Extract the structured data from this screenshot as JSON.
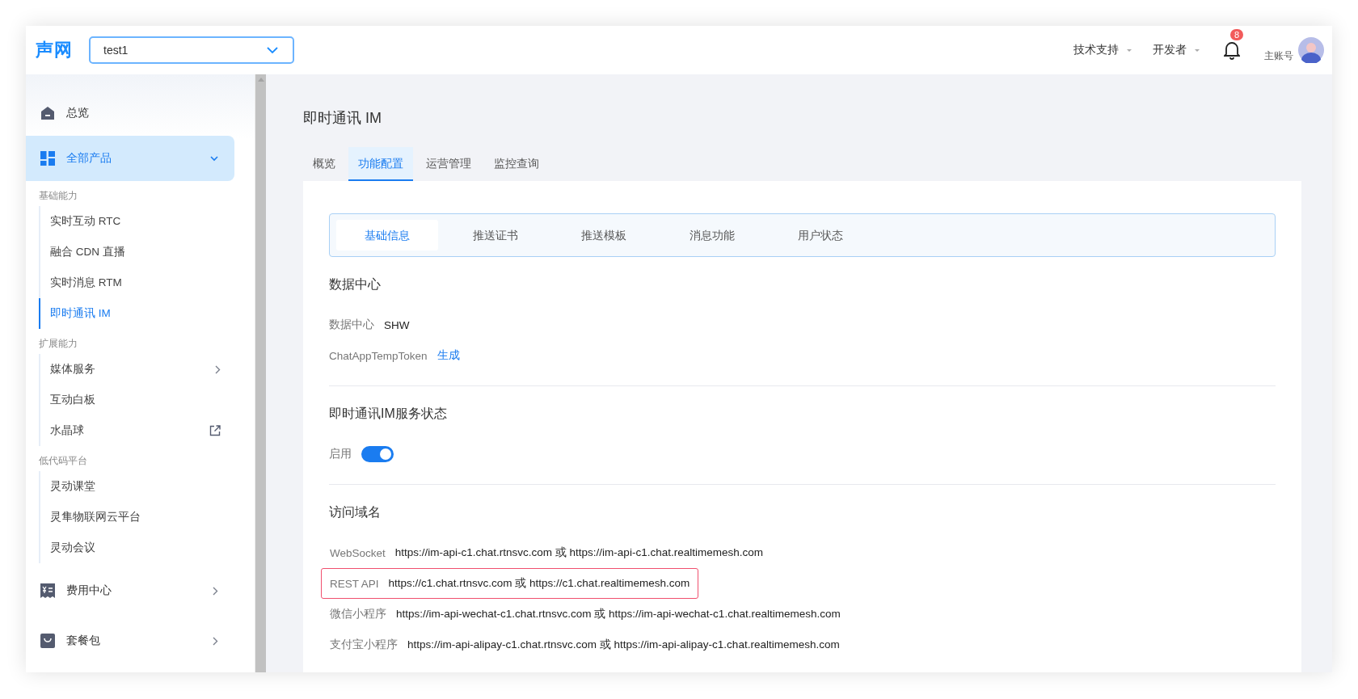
{
  "header": {
    "logo": "声网",
    "project_select": {
      "value": "test1"
    },
    "menus": [
      {
        "label": "技术支持"
      },
      {
        "label": "开发者"
      }
    ],
    "notifications": {
      "count": "8"
    },
    "account": {
      "role": "主账号"
    }
  },
  "sidebar": {
    "top_items": [
      {
        "label": "总览",
        "kind": "home"
      }
    ],
    "products": {
      "label": "全部产品",
      "expanded": true,
      "groups": [
        {
          "title": "基础能力",
          "items": [
            {
              "label": "实时互动 RTC",
              "kind": "plain",
              "selected": false
            },
            {
              "label": "融合 CDN 直播",
              "kind": "plain",
              "selected": false
            },
            {
              "label": "实时消息 RTM",
              "kind": "plain",
              "selected": false
            },
            {
              "label": "即时通讯 IM",
              "kind": "plain",
              "selected": true
            }
          ]
        },
        {
          "title": "扩展能力",
          "items": [
            {
              "label": "媒体服务",
              "kind": "submenu",
              "selected": false
            },
            {
              "label": "互动白板",
              "kind": "plain",
              "selected": false
            },
            {
              "label": "水晶球",
              "kind": "external",
              "selected": false
            }
          ]
        },
        {
          "title": "低代码平台",
          "items": [
            {
              "label": "灵动课堂",
              "kind": "plain",
              "selected": false
            },
            {
              "label": "灵隼物联网云平台",
              "kind": "plain",
              "selected": false
            },
            {
              "label": "灵动会议",
              "kind": "plain",
              "selected": false
            }
          ]
        }
      ]
    },
    "bottom_items": [
      {
        "label": "费用中心",
        "kind": "bill"
      },
      {
        "label": "套餐包",
        "kind": "bag"
      }
    ]
  },
  "page": {
    "title": "即时通讯 IM",
    "tabs": [
      {
        "label": "概览",
        "selected": false
      },
      {
        "label": "功能配置",
        "selected": true
      },
      {
        "label": "运营管理",
        "selected": false
      },
      {
        "label": "监控查询",
        "selected": false
      }
    ],
    "subtabs": [
      {
        "label": "基础信息",
        "selected": true
      },
      {
        "label": "推送证书",
        "selected": false
      },
      {
        "label": "推送模板",
        "selected": false
      },
      {
        "label": "消息功能",
        "selected": false
      },
      {
        "label": "用户状态",
        "selected": false
      }
    ],
    "sections": [
      {
        "kind": "fields",
        "title": "数据中心",
        "fields": [
          {
            "label": "数据中心",
            "value": "SHW",
            "kind": "text"
          },
          {
            "label": "ChatAppTempToken",
            "value": "生成",
            "kind": "link"
          }
        ]
      },
      {
        "kind": "toggle",
        "title": "即时通讯IM服务状态",
        "toggle": {
          "label": "启用",
          "on": true
        }
      },
      {
        "kind": "domains",
        "title": "访问域名",
        "rows": [
          {
            "label": "WebSocket",
            "value": "https://im-api-c1.chat.rtnsvc.com 或 https://im-api-c1.chat.realtimemesh.com",
            "highlighted": false
          },
          {
            "label": "REST API",
            "value": "https://c1.chat.rtnsvc.com 或 https://c1.chat.realtimemesh.com",
            "highlighted": true
          },
          {
            "label": "微信小程序",
            "value": "https://im-api-wechat-c1.chat.rtnsvc.com 或 https://im-api-wechat-c1.chat.realtimemesh.com",
            "highlighted": false
          },
          {
            "label": "支付宝小程序",
            "value": "https://im-api-alipay-c1.chat.rtnsvc.com 或 https://im-api-alipay-c1.chat.realtimemesh.com",
            "highlighted": false
          }
        ]
      }
    ]
  }
}
